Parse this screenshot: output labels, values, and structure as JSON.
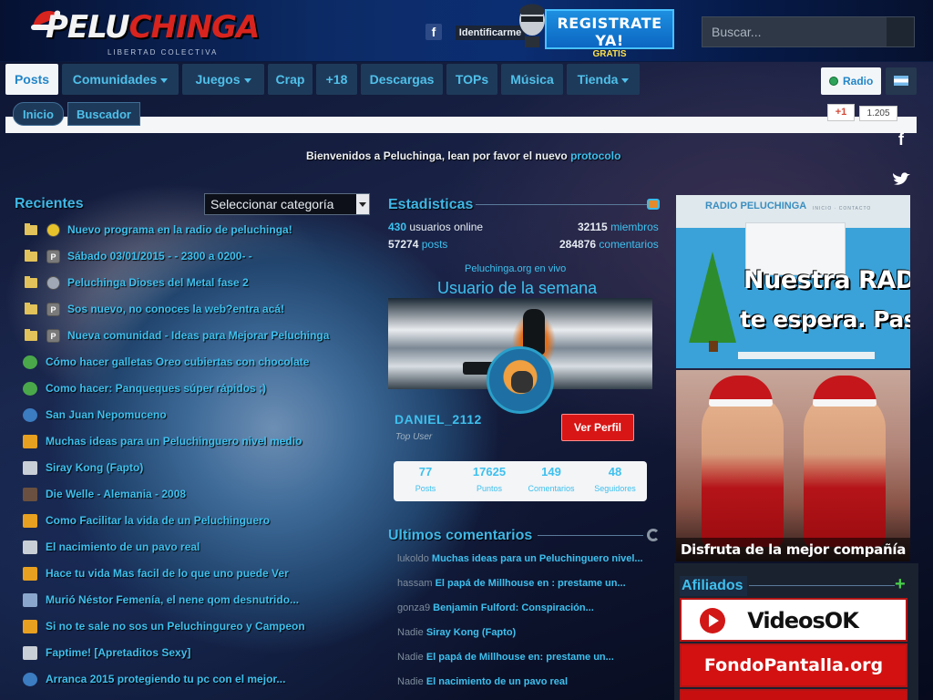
{
  "header": {
    "logo_text_a": "PELU",
    "logo_text_b": "CHINGA",
    "tagline": "LIBERTAD COLECTIVA",
    "identify_label": "Identificarme",
    "register_label": "REGISTRATE YA!",
    "register_sublabel": "GRATIS",
    "search_placeholder": "Buscar..."
  },
  "nav": {
    "items": [
      {
        "label": "Posts",
        "active": true,
        "dropdown": false
      },
      {
        "label": "Comunidades",
        "active": false,
        "dropdown": true
      },
      {
        "label": "Juegos",
        "active": false,
        "dropdown": true
      },
      {
        "label": "Crap",
        "active": false,
        "dropdown": false
      },
      {
        "label": "+18",
        "active": false,
        "dropdown": false
      },
      {
        "label": "Descargas",
        "active": false,
        "dropdown": false
      },
      {
        "label": "TOPs",
        "active": false,
        "dropdown": false
      },
      {
        "label": "Música",
        "active": false,
        "dropdown": false
      },
      {
        "label": "Tienda",
        "active": false,
        "dropdown": true
      }
    ],
    "radio_label": "Radio",
    "subnav": [
      "Inicio",
      "Buscador"
    ],
    "gplus_label": "+1",
    "gplus_count": "1.205"
  },
  "welcome": {
    "text": "Bienvenidos a Peluchinga, lean por favor el nuevo ",
    "link": "protocolo"
  },
  "recent": {
    "title": "Recientes",
    "select_value": "Seleccionar categoría",
    "posts": [
      {
        "title": "Nuevo programa en la radio de peluchinga!",
        "folder": true,
        "icon": "yellow"
      },
      {
        "title": "Sábado 03/01/2015 - - 2300 a 0200- -",
        "folder": true,
        "icon": "P"
      },
      {
        "title": "Peluchinga Dioses del Metal fase 2",
        "folder": true,
        "icon": "guitar"
      },
      {
        "title": "Sos nuevo, no conoces la web?entra acá!",
        "folder": true,
        "icon": "P"
      },
      {
        "title": "Nueva comunidad - Ideas para Mejorar Peluchinga",
        "folder": true,
        "icon": "P"
      },
      {
        "title": "Cómo hacer galletas Oreo cubiertas con chocolate",
        "folder": false,
        "icon": "food"
      },
      {
        "title": "Como hacer: Panqueques súper rápidos ;)",
        "folder": false,
        "icon": "food"
      },
      {
        "title": "San Juan Nepomuceno",
        "folder": false,
        "icon": "globe"
      },
      {
        "title": "Muchas ideas para un Peluchinguero nivel medio",
        "folder": false,
        "icon": "chart"
      },
      {
        "title": "Siray Kong (Fapto)",
        "folder": false,
        "icon": "pc"
      },
      {
        "title": "Die Welle - Alemania - 2008",
        "folder": false,
        "icon": "film"
      },
      {
        "title": "Como Facilitar la vida de un Peluchinguero",
        "folder": false,
        "icon": "chart"
      },
      {
        "title": "El nacimiento de un pavo real",
        "folder": false,
        "icon": "pc"
      },
      {
        "title": "Hace tu vida Mas facil de lo que uno puede Ver",
        "folder": false,
        "icon": "chart"
      },
      {
        "title": "Murió Néstor Femenía, el nene qom desnutrido...",
        "folder": false,
        "icon": "news"
      },
      {
        "title": "Si no te sale no sos un Peluchingureo y Campeon",
        "folder": false,
        "icon": "chart"
      },
      {
        "title": "Faptime! [Apretaditos Sexy]",
        "folder": false,
        "icon": "pc"
      },
      {
        "title": "Arranca 2015 protegiendo tu pc con el mejor...",
        "folder": false,
        "icon": "globe"
      }
    ]
  },
  "stats": {
    "title": "Estadisticas",
    "online_num": "430",
    "online_label": "usuarios online",
    "members_num": "32115",
    "members_label": "miembros",
    "posts_num": "57274",
    "posts_label": "posts",
    "comments_num": "284876",
    "comments_label": "comentarios",
    "live_link": "Peluchinga.org en vivo"
  },
  "user_week": {
    "title": "Usuario de la semana",
    "username": "DANIEL_2112",
    "rank": "Top User",
    "profile_button": "Ver Perfil",
    "stats": [
      {
        "value": "77",
        "label": "Posts"
      },
      {
        "value": "17625",
        "label": "Puntos"
      },
      {
        "value": "149",
        "label": "Comentarios"
      },
      {
        "value": "48",
        "label": "Seguidores"
      }
    ]
  },
  "last_comments": {
    "title": "Ultimos comentarios",
    "items": [
      {
        "user": "lukoldo",
        "post": "Muchas ideas para un Peluchinguero nivel..."
      },
      {
        "user": "hassam",
        "post": "El papá de Millhouse en : prestame un..."
      },
      {
        "user": "gonza9",
        "post": "Benjamin Fulford: Conspiración..."
      },
      {
        "user": "Nadie",
        "post": "Siray Kong (Fapto)"
      },
      {
        "user": "Nadie",
        "post": "El papá de Millhouse en: prestame un..."
      },
      {
        "user": "Nadie",
        "post": "El nacimiento de un pavo real"
      }
    ]
  },
  "radio_banner": {
    "brand": "RADIO PELUCHINGA",
    "nav": "INICIO · CONTACTO",
    "line1": "Nuestra RADIO",
    "line2": "te espera. Pasa"
  },
  "promo_banner": {
    "caption": "Disfruta de la mejor compañía"
  },
  "affiliates": {
    "title": "Afiliados",
    "items": [
      "VideosOK",
      "FondoPantalla.org"
    ]
  },
  "colors": {
    "accent": "#3ec0ee",
    "nav_bg": "#1e3a5a",
    "profile_button": "#d81616",
    "register_button": "#1d8fe0"
  }
}
